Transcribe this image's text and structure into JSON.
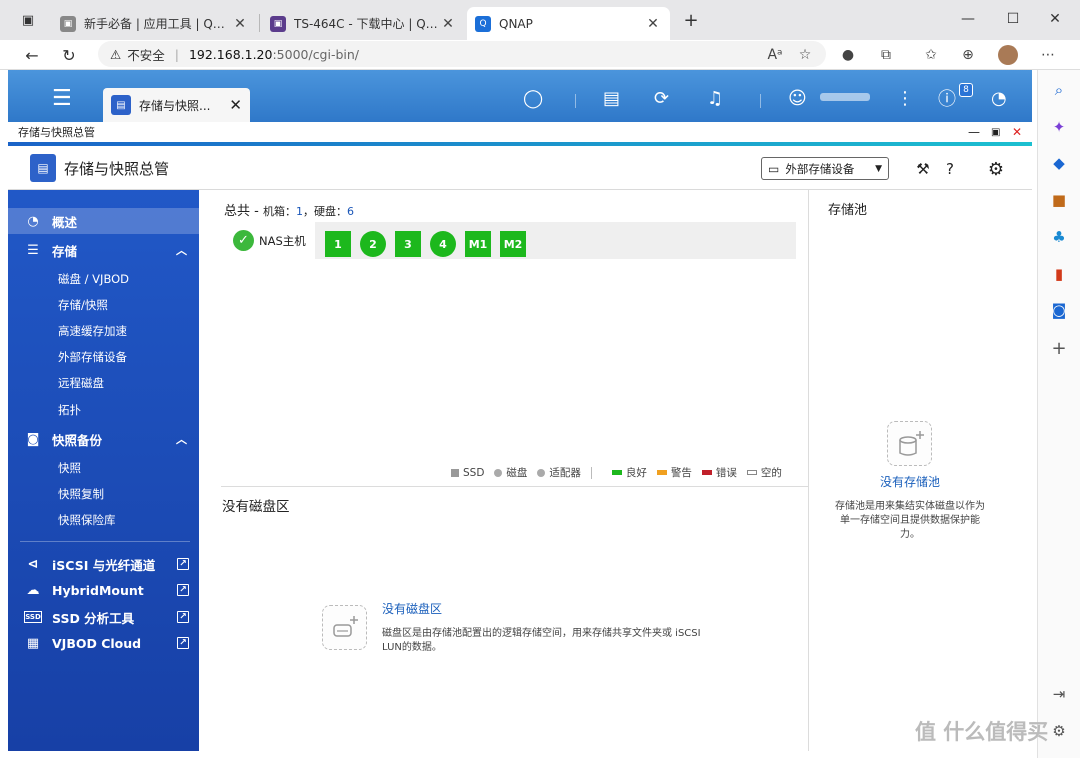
{
  "browser": {
    "tabs": [
      {
        "title": "新手必备 | 应用工具 | QNAP",
        "favicon": "page-icon"
      },
      {
        "title": "TS-464C - 下载中心 | QNAP",
        "favicon": "page-icon"
      },
      {
        "title": "QNAP",
        "favicon": "qnap-icon"
      }
    ],
    "security_label": "不安全",
    "url_host": "192.168.1.20",
    "url_rest": ":5000/cgi-bin/"
  },
  "header": {
    "app_tab_title": "存储与快照...",
    "notification_badge": "8"
  },
  "app": {
    "title_bar": "存储与快照总管",
    "name": "存储与快照总管",
    "external_device_button": "外部存储设备"
  },
  "sidebar": {
    "overview": "概述",
    "storage": "存储",
    "storage_items": [
      "磁盘 / VJBOD",
      "存储/快照",
      "高速缓存加速",
      "外部存储设备",
      "远程磁盘",
      "拓扑"
    ],
    "snapshot_backup": "快照备份",
    "snapshot_items": [
      "快照",
      "快照复制",
      "快照保险库"
    ],
    "links": [
      "iSCSI 与光纤通道",
      "HybridMount",
      "SSD 分析工具",
      "VJBOD Cloud"
    ]
  },
  "summary": {
    "label_total": "总共 - ",
    "label_enclosure": "机箱：",
    "enclosure_count": "1",
    "label_disks": "，硬盘：",
    "disk_count": "6"
  },
  "nas_host": "NAS主机",
  "disks": [
    {
      "label": "1",
      "shape": "square"
    },
    {
      "label": "2",
      "shape": "round"
    },
    {
      "label": "3",
      "shape": "square"
    },
    {
      "label": "4",
      "shape": "round"
    },
    {
      "label": "M1",
      "shape": "square"
    },
    {
      "label": "M2",
      "shape": "square"
    }
  ],
  "legend": {
    "ssd": "SSD",
    "disk": "磁盘",
    "adapter": "适配器",
    "good": "良好",
    "warning": "警告",
    "error": "错误",
    "empty": "空的"
  },
  "colors": {
    "good": "#1db81d",
    "warning": "#f0a020",
    "error": "#c0202a",
    "link": "#1a5fbb",
    "sidebar": "#1e4fbf"
  },
  "volume": {
    "title": "没有磁盘区",
    "link": "没有磁盘区",
    "description": "磁盘区是由存储池配置出的逻辑存储空间，用来存储共享文件夹或 iSCSI LUN的数据。"
  },
  "pool": {
    "title": "存储池",
    "link": "没有存储池",
    "description": "存储池是用来集结实体磁盘以作为单一存储空间且提供数据保护能力。"
  },
  "watermark": "值 什么值得买"
}
